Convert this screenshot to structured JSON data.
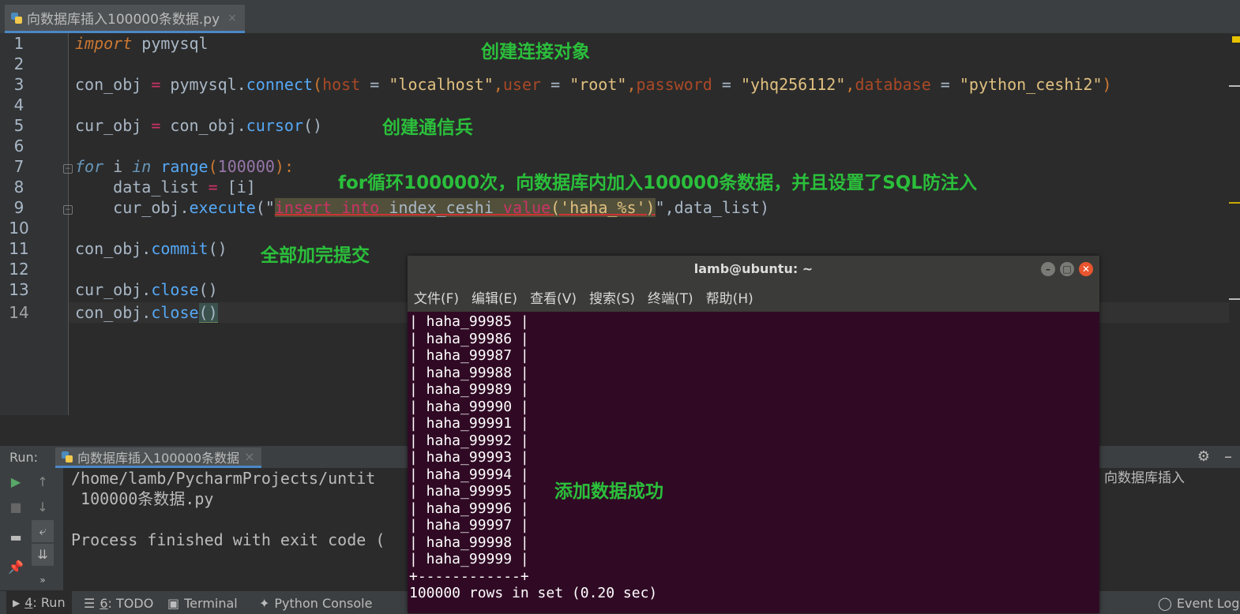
{
  "editor_tab": {
    "file_name": "向数据库插入100000条数据.py",
    "close": "×"
  },
  "code": {
    "line_numbers": [
      "1",
      "2",
      "3",
      "4",
      "5",
      "6",
      "7",
      "8",
      "9",
      "10",
      "11",
      "12",
      "13",
      "14"
    ],
    "l1": {
      "kw": "import",
      "rest": " pymysql"
    },
    "l3": {
      "a": "con_obj ",
      "eq": "=",
      "b": " pymysql.",
      "fn": "connect",
      "p1": "(",
      "host": "host",
      "eq1": " = ",
      "host_val": "\"localhost\"",
      "c1": ",",
      "user": "user",
      "eq2": " = ",
      "user_val": "\"root\"",
      "c2": ",",
      "password": "password",
      "eq3": " = ",
      "password_val": "\"yhq256112\"",
      "c3": ",",
      "database": "database",
      "eq4": " = ",
      "database_val": "\"python_ceshi2\"",
      "p2": ")"
    },
    "l5": {
      "a": "cur_obj ",
      "eq": "=",
      "b": " con_obj.",
      "fn": "cursor",
      "p": "()"
    },
    "l7": {
      "for": "for",
      "i": " i ",
      "in": "in",
      "sp": " ",
      "range": "range",
      "p1": "(",
      "num": "100000",
      "p2": "):"
    },
    "l8": {
      "a": "    data_list ",
      "eq": "=",
      "b": " [i]"
    },
    "l9": {
      "a": "    cur_obj.",
      "fn": "execute",
      "p1": "(\"",
      "insert": "insert",
      "sp1": " ",
      "into": "into",
      "sp2": " ",
      "table": "index_ceshi",
      "sp3": " ",
      "value": "value",
      "arg": "('haha_%s')",
      "p2": "\",data_list)"
    },
    "l11": {
      "a": "con_obj.",
      "fn": "commit",
      "p": "()"
    },
    "l13": {
      "a": "cur_obj.",
      "fn": "close",
      "p": "()"
    },
    "l14": {
      "a": "con_obj.",
      "fn": "close",
      "p": "()"
    }
  },
  "annotations": {
    "create_connection": "创建连接对象",
    "create_cursor": "创建通信兵",
    "loop_note": "for循环100000次，向数据库内加入100000条数据，并且设置了SQL防注入",
    "commit_note": "全部加完提交",
    "success": "添加数据成功"
  },
  "run_panel": {
    "label": "Run:",
    "tab_label": "向数据库插入100000条数据",
    "tab_close": "×",
    "output_path": "/home/lamb/PycharmProjects/untit",
    "output_path_tail": "向数据库插入",
    "output_line2": " 100000条数据.py",
    "output_line3": "Process finished with exit code ("
  },
  "status_bar": {
    "run_num": "4",
    "run_label": ": Run",
    "todo_num": "6",
    "todo_label": ": TODO",
    "terminal": "Terminal",
    "python_console": "Python Console",
    "event_log": "Event Log"
  },
  "terminal": {
    "title": "lamb@ubuntu: ~",
    "menu": [
      "文件(F)",
      "编辑(E)",
      "查看(V)",
      "搜索(S)",
      "终端(T)",
      "帮助(H)"
    ],
    "rows": [
      "| haha_99985 |",
      "| haha_99986 |",
      "| haha_99987 |",
      "| haha_99988 |",
      "| haha_99989 |",
      "| haha_99990 |",
      "| haha_99991 |",
      "| haha_99992 |",
      "| haha_99993 |",
      "| haha_99994 |",
      "| haha_99995 |",
      "| haha_99996 |",
      "| haha_99997 |",
      "| haha_99998 |",
      "| haha_99999 |",
      "+------------+",
      "100000 rows in set (0.20 sec)"
    ]
  },
  "colors": {
    "editor_bg": "#2b2b2b",
    "terminal_bg": "#300a24",
    "annotation": "#2bbf3b",
    "keyword": "#cc7832",
    "string": "#6a8759"
  }
}
